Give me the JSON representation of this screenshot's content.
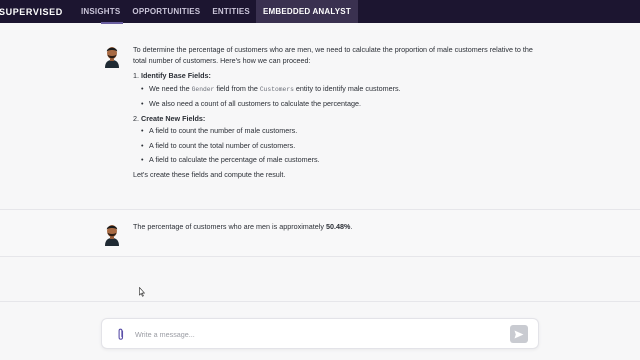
{
  "header": {
    "brand": "SUPERVISED",
    "nav": [
      {
        "label": "INSIGHTS",
        "active": false
      },
      {
        "label": "OPPORTUNITIES",
        "active": false
      },
      {
        "label": "ENTITIES",
        "active": false
      },
      {
        "label": "EMBEDDED ANALYST",
        "active": true
      }
    ]
  },
  "conversation": {
    "message1": {
      "intro": "To determine the percentage of customers who are men, we need to calculate the proportion of male customers relative to the total number of customers. Here's how we can proceed:",
      "step1": {
        "number": "1.",
        "title": "Identify Base Fields:",
        "bullet1": {
          "pre": "We need the",
          "code1": "Gender",
          "mid": "field from the",
          "code2": "Customers",
          "post": "entity to identify male customers."
        },
        "bullet2": "We also need a count of all customers to calculate the percentage."
      },
      "step2": {
        "number": "2.",
        "title": "Create New Fields:",
        "bullets": [
          "A field to count the number of male customers.",
          "A field to count the total number of customers.",
          "A field to calculate the percentage of male customers."
        ]
      },
      "outro": "Let's create these fields and compute the result."
    },
    "message2": {
      "text": "The percentage of customers who are men is approximately",
      "value": "50.48%",
      "suffix": "."
    }
  },
  "composer": {
    "placeholder": "Write a message..."
  },
  "colors": {
    "topbar": "#1c1530",
    "active_tab": "#3a3150",
    "send_button": "#c9cbd1"
  },
  "icons": [
    "avatar-icon",
    "paperclip-icon",
    "send-icon",
    "mouse-cursor-icon"
  ]
}
